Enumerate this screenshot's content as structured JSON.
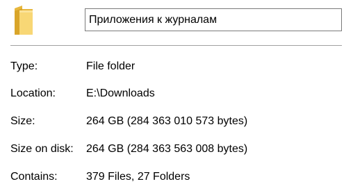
{
  "folder": {
    "icon": "folder-icon",
    "name": "Приложения к журналам"
  },
  "properties": {
    "type": {
      "label": "Type:",
      "value": "File folder"
    },
    "location": {
      "label": "Location:",
      "value": "E:\\Downloads"
    },
    "size": {
      "label": "Size:",
      "value": "264 GB (284 363 010 573 bytes)"
    },
    "size_on_disk": {
      "label": "Size on disk:",
      "value": "264 GB (284 363 563 008 bytes)"
    },
    "contains": {
      "label": "Contains:",
      "value": "379 Files, 27 Folders"
    }
  },
  "colors": {
    "folder_body": "#f8d775",
    "folder_back": "#e7b73d",
    "border": "#7a7a7a",
    "divider": "#a0a0a0"
  }
}
